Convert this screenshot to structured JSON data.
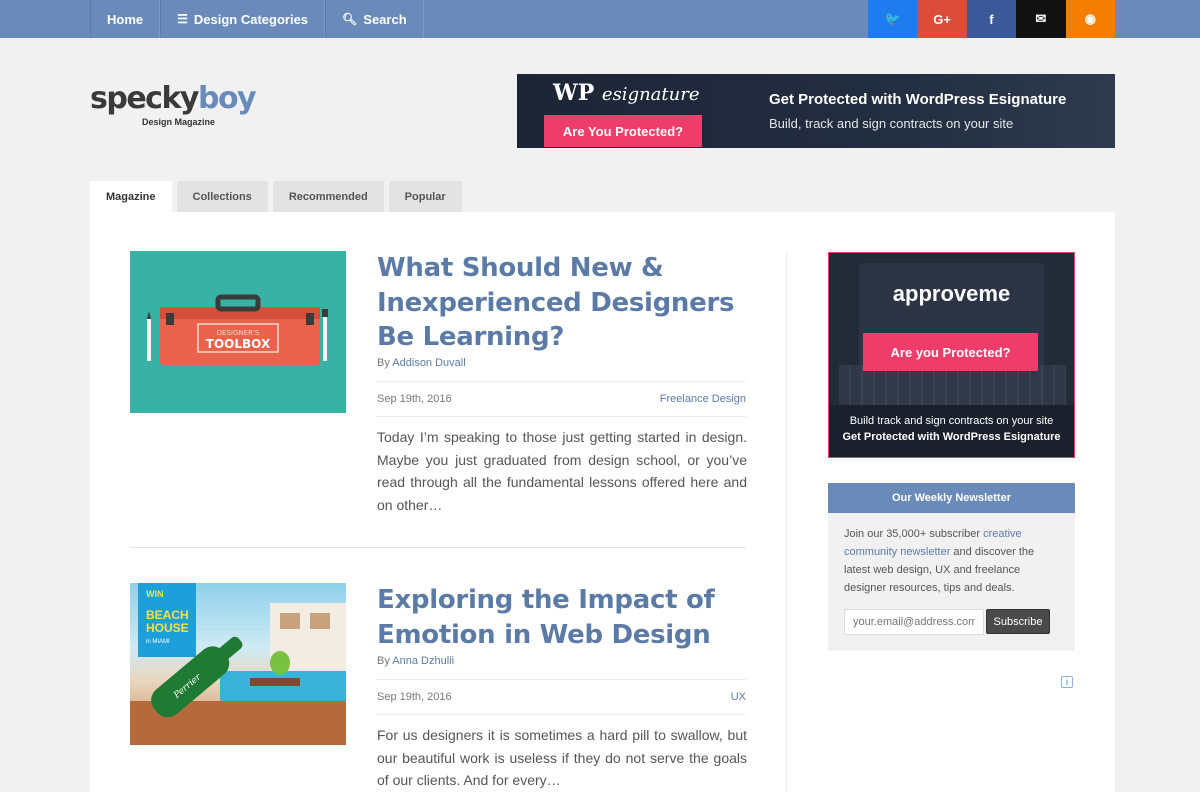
{
  "nav": {
    "home": "Home",
    "categories": "Design Categories",
    "search": "Search"
  },
  "social": [
    {
      "icon": "twitter-icon",
      "glyph": "🐦",
      "color": "#1e7cf0"
    },
    {
      "icon": "google-plus-icon",
      "glyph": "G+",
      "color": "#dd4b39"
    },
    {
      "icon": "facebook-icon",
      "glyph": "f",
      "color": "#3b5998"
    },
    {
      "icon": "email-icon",
      "glyph": "✉",
      "color": "#111111"
    },
    {
      "icon": "rss-icon",
      "glyph": "◉",
      "color": "#f57d00"
    }
  ],
  "logo": {
    "name_part1": "specky",
    "name_part2": "boy",
    "tagline": "Design Magazine"
  },
  "banner": {
    "brand": "WP",
    "brand_script": "esignature",
    "button": "Are You Protected?",
    "headline": "Get Protected with WordPress Esignature",
    "subline": "Build, track and sign contracts on your site"
  },
  "tabs": [
    "Magazine",
    "Collections",
    "Recommended",
    "Popular"
  ],
  "posts": [
    {
      "title": "What Should New & Inexperienced Designers Be Learning?",
      "by_prefix": "By",
      "author": "Addison Duvall",
      "date": "Sep 19th, 2016",
      "category": "Freelance Design",
      "excerpt": "Today I’m speaking to those just getting started in design. Maybe you just graduated from design school, or you’ve read through all the fundamental lessons offered here and on other…",
      "thumb_line1": "DESIGNER'S",
      "thumb_line2": "TOOLBOX"
    },
    {
      "title": "Exploring the Impact of Emotion in Web Design",
      "by_prefix": "By",
      "author": "Anna Dzhulii",
      "date": "Sep 19th, 2016",
      "category": "UX",
      "excerpt": "For us designers it is sometimes a hard pill to swallow, but our beautiful work is useless if they do not serve the goals of our clients. And for every…",
      "thumb_win": "WIN",
      "thumb_beach": "BEACH",
      "thumb_house": "HOUSE",
      "thumb_miami": "in MIAMI",
      "thumb_brand": "Perrier"
    }
  ],
  "sidebar_ad": {
    "brand": "approveme",
    "button": "Are you Protected?",
    "line1": "Build track and sign contracts on your site",
    "line2": "Get Protected with WordPress Esignature"
  },
  "newsletter": {
    "title": "Our Weekly Newsletter",
    "text_before": "Join our 35,000+ subscriber ",
    "link": "creative community newsletter",
    "text_after": " and discover the latest web design, UX and freelance designer resources, tips and deals.",
    "placeholder": "your.email@address.com",
    "button": "Subscribe"
  },
  "adchoice": "i"
}
